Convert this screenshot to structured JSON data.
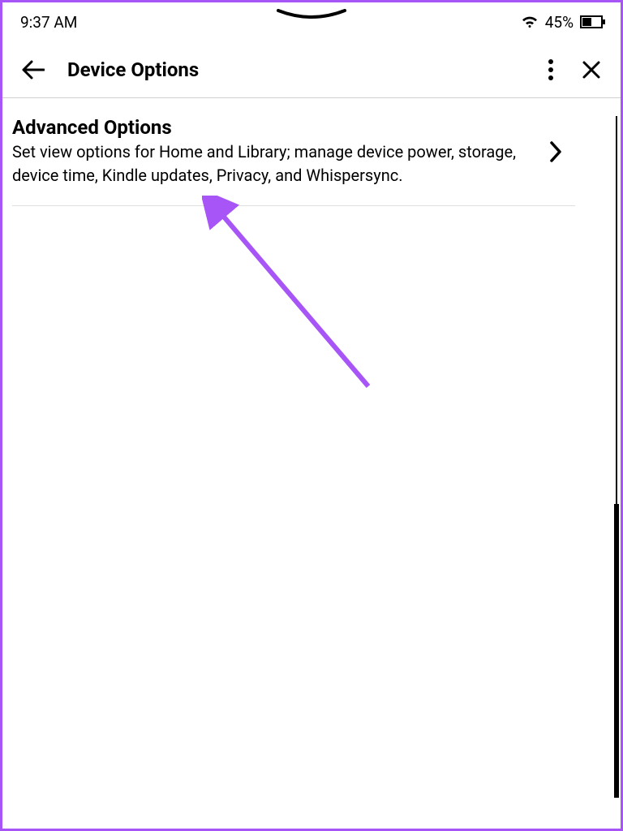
{
  "status": {
    "time": "9:37 AM",
    "battery_percent": "45%"
  },
  "header": {
    "title": "Device Options"
  },
  "items": [
    {
      "title": "Advanced Options",
      "description": "Set view options for Home and Library; manage device power, storage, device time, Kindle updates, Privacy, and Whispersync."
    }
  ]
}
